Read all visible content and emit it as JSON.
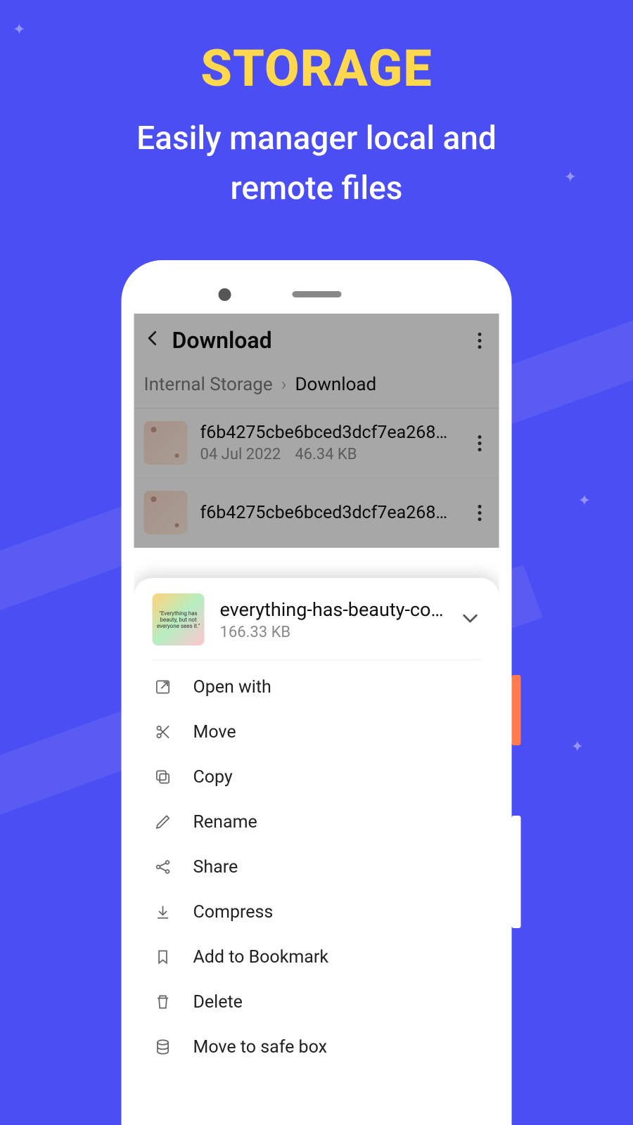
{
  "promo": {
    "headline": "STORAGE",
    "subhead_line1": "Easily manager local and",
    "subhead_line2": "remote files"
  },
  "app": {
    "title": "Download",
    "breadcrumb": {
      "root": "Internal Storage",
      "current": "Download"
    }
  },
  "files": [
    {
      "name": "f6b4275cbe6bced3dcf7ea2688...",
      "date": "04 Jul 2022",
      "size": "46.34 KB"
    },
    {
      "name": "f6b4275cbe6bced3dcf7ea2688...",
      "date": "",
      "size": ""
    }
  ],
  "sheet": {
    "title": "everything-has-beauty-co...",
    "size": "166.33 KB",
    "thumb_text": "\"Everything has beauty, but not everyone sees it.\"",
    "actions": [
      "Open with",
      "Move",
      "Copy",
      "Rename",
      "Share",
      "Compress",
      "Add to Bookmark",
      "Delete",
      "Move to safe box"
    ]
  }
}
